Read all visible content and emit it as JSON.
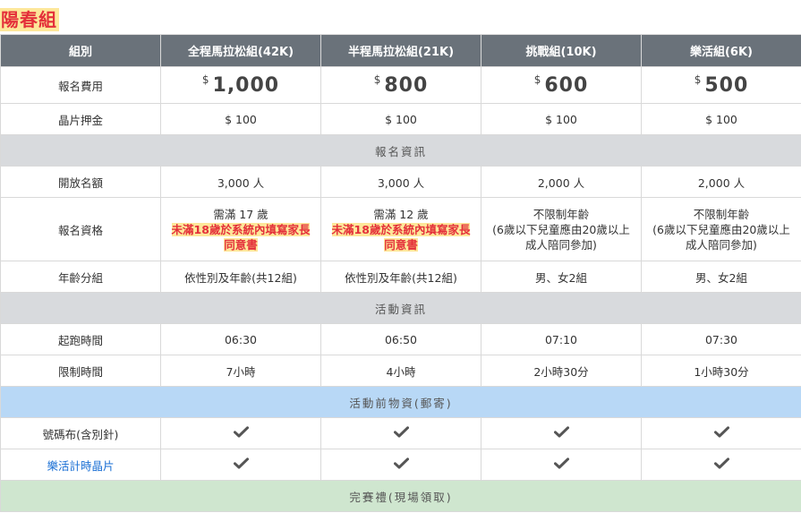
{
  "page_title": "陽春組",
  "header": {
    "columns": [
      "組別",
      "全程馬拉松組(42K)",
      "半程馬拉松組(21K)",
      "挑戰組(10K)",
      "樂活組(6K)"
    ]
  },
  "rows": {
    "fee": {
      "label": "報名費用",
      "currency": "$",
      "values": [
        "1,000",
        "800",
        "600",
        "500"
      ]
    },
    "deposit": {
      "label": "晶片押金",
      "values": [
        "$ 100",
        "$ 100",
        "$ 100",
        "$ 100"
      ]
    },
    "section_registration": "報名資訊",
    "quota": {
      "label": "開放名額",
      "values": [
        "3,000 人",
        "3,000 人",
        "2,000 人",
        "2,000 人"
      ]
    },
    "eligibility": {
      "label": "報名資格",
      "full": {
        "line1": "需滿 17 歲",
        "warn1": "未滿18歲於系統內填寫家長",
        "warn2": "同意書"
      },
      "half": {
        "line1": "需滿 12 歲",
        "warn1": "未滿18歲於系統內填寫家長",
        "warn2": "同意書"
      },
      "challenge": {
        "line1": "不限制年齡",
        "line2": "(6歲以下兒童應由20歲以上",
        "line3": "成人陪同參加)"
      },
      "leisure": {
        "line1": "不限制年齡",
        "line2": "(6歲以下兒童應由20歲以上",
        "line3": "成人陪同參加)"
      }
    },
    "age_groups": {
      "label": "年齡分組",
      "values": [
        "依性別及年齡(共12組)",
        "依性別及年齡(共12組)",
        "男、女2組",
        "男、女2組"
      ]
    },
    "section_activity": "活動資訊",
    "start_time": {
      "label": "起跑時間",
      "values": [
        "06:30",
        "06:50",
        "07:10",
        "07:30"
      ]
    },
    "time_limit": {
      "label": "限制時間",
      "values": [
        "7小時",
        "4小時",
        "2小時30分",
        "1小時30分"
      ]
    },
    "section_pre_event": "活動前物資(郵寄)",
    "bib": {
      "label": "號碼布(含別針)",
      "checks": [
        true,
        true,
        true,
        true
      ]
    },
    "chip": {
      "label": "樂活計時晶片",
      "checks": [
        true,
        true,
        true,
        true
      ]
    },
    "section_finish": "完賽禮(現場領取)"
  },
  "colors": {
    "header_bg": "#6a727a",
    "highlight_bg": "#fde79a",
    "highlight_text": "#e4303a",
    "section_gray": "#d8dadd",
    "section_blue": "#b8d8f6",
    "section_green": "#cfe6cf",
    "link_blue": "#1a6fd4"
  },
  "icons": {
    "check": "check-icon"
  }
}
